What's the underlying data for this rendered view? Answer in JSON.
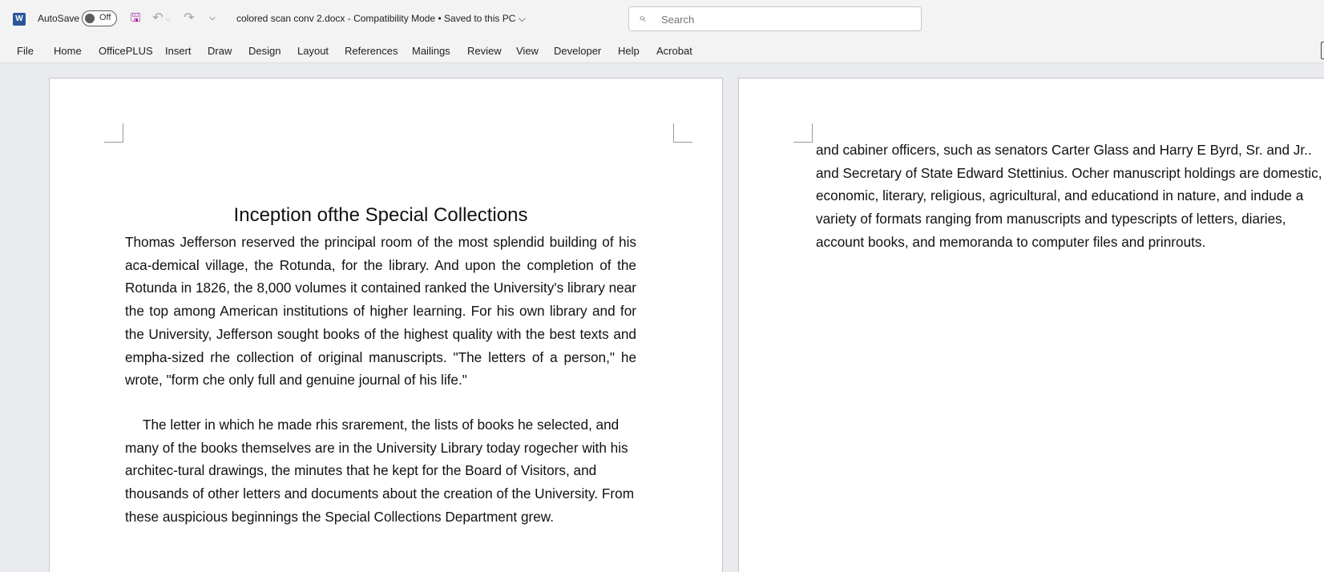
{
  "titlebar": {
    "app_icon": "word-icon",
    "app_icon_letter": "W",
    "autosave_label": "AutoSave",
    "autosave_state": "Off",
    "save_icon_glyph": "🖫",
    "undo_icon_glyph": "↶",
    "undo_caret_glyph": "⌵",
    "redo_icon_glyph": "↷",
    "more_glyph": "⌵",
    "document_title": "colored scan conv 2.docx  -  Compatibility Mode  •  Saved to this PC ⌵"
  },
  "search": {
    "placeholder": "Search",
    "icon_glyph": "⌕"
  },
  "ribbon": {
    "tabs": [
      "File",
      "Home",
      "OfficePLUS",
      "Insert",
      "Draw",
      "Design",
      "Layout",
      "References",
      "Mailings",
      "Review",
      "View",
      "Developer",
      "Help",
      "Acrobat"
    ]
  },
  "document": {
    "heading": "Inception ofthe Special Collections",
    "paragraphs": [
      "Thomas Jefferson reserved the principal room of the most splendid building of his aca-demical village, the Rotunda, for the library. And upon the completion of the Rotunda in 1826, the 8,000 volumes it contained ranked the University's library near the top among American institutions of higher learning. For his own library and for the University, Jefferson sought books of the highest quality with the best texts and empha-sized rhe collection of original manuscripts. \"The letters of a person,\" he wrote, \"form che only full and genuine journal of his life.\"",
      "The letter in which he made rhis srarement, the lists of books he selected, and many of the books themselves are in the University Library today rogecher with his architec-tural drawings, the minutes that he kept for the Board of Visitors, and thousands of other letters and documents about the creation of the University. From these auspicious beginnings the Special Collections Department grew.",
      "and cabiner officers, such as senators Carter Glass and Harry E Byrd, Sr. and Jr.. and Secretary of State Edward Stettinius. Ocher manuscript holdings are domestic, economic, literary, religious, agricultural, and educationd in nature, and indude a variety of formats ranging from manuscripts and typescripts of letters, diaries, account books, and memoranda to computer files and prinrouts."
    ]
  },
  "colors": {
    "word_blue": "#2b579a",
    "save_purple": "#a42aa1",
    "chrome_bg": "#f3f3f3",
    "canvas_bg": "#e9ebee"
  }
}
